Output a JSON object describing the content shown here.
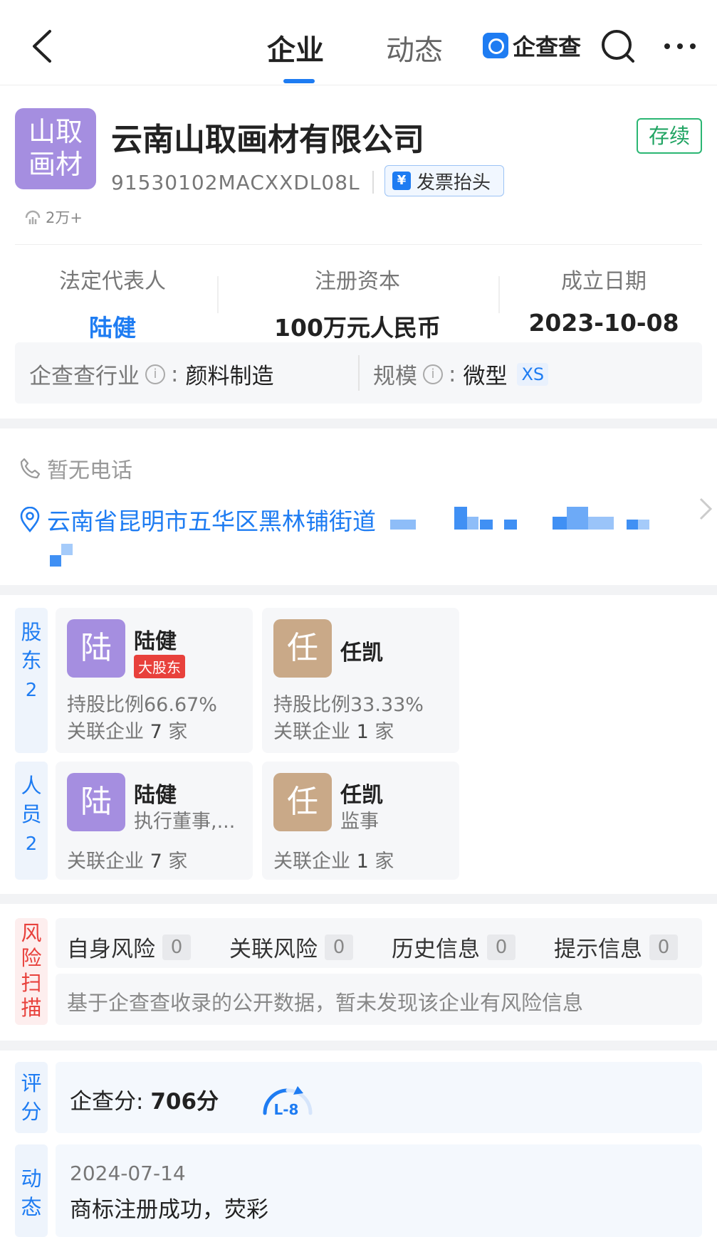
{
  "nav": {
    "tab_company": "企业",
    "tab_news": "动态",
    "brand": "企查查"
  },
  "company": {
    "logo_line1": "山取",
    "logo_line2": "画材",
    "name": "云南山取画材有限公司",
    "status": "存续",
    "credit_code": "91530102MACXXDL08L",
    "invoice_label": "发票抬头",
    "views": "2万+"
  },
  "key_info": {
    "legal_rep_label": "法定代表人",
    "legal_rep_value": "陆健",
    "capital_label": "注册资本",
    "capital_value": "100万元人民币",
    "founded_label": "成立日期",
    "founded_value": "2023-10-08"
  },
  "industry": {
    "industry_label": "企查查行业",
    "industry_value": "颜料制造",
    "scale_label": "规模",
    "scale_value": "微型",
    "scale_badge": "XS",
    "colon": ":"
  },
  "contact": {
    "phone": "暂无电话",
    "address": "云南省昆明市五华区黑林铺街道"
  },
  "shareholders": {
    "tag": "股东",
    "count": "2",
    "items": [
      {
        "avatar": "陆",
        "name": "陆健",
        "badge": "大股东",
        "ratio": "持股比例66.67%",
        "related_label": "关联企业",
        "related_count": "7",
        "related_unit": "家"
      },
      {
        "avatar": "任",
        "name": "任凯",
        "ratio": "持股比例33.33%",
        "related_label": "关联企业",
        "related_count": "1",
        "related_unit": "家"
      }
    ]
  },
  "people": {
    "tag": "人员",
    "count": "2",
    "items": [
      {
        "avatar": "陆",
        "name": "陆健",
        "role": "执行董事,...",
        "related_label": "关联企业",
        "related_count": "7",
        "related_unit": "家"
      },
      {
        "avatar": "任",
        "name": "任凯",
        "role": "监事",
        "related_label": "关联企业",
        "related_count": "1",
        "related_unit": "家"
      }
    ]
  },
  "risk": {
    "tag": "风险扫描",
    "items": [
      {
        "label": "自身风险",
        "count": "0"
      },
      {
        "label": "关联风险",
        "count": "0"
      },
      {
        "label": "历史信息",
        "count": "0"
      },
      {
        "label": "提示信息",
        "count": "0"
      }
    ],
    "note": "基于企查查收录的公开数据，暂未发现该企业有风险信息"
  },
  "score": {
    "tag": "评分",
    "label": "企查分:",
    "value": "706分",
    "level": "L-8"
  },
  "news": {
    "tag": "动态",
    "date": "2024-07-14",
    "text": "商标注册成功，荧彩"
  },
  "colors": {
    "accent": "#1e7cf2",
    "status_green": "#21a463",
    "risk_red": "#e8413c",
    "avatar_purple": "#a58ee0",
    "avatar_tan": "#c9a988"
  }
}
